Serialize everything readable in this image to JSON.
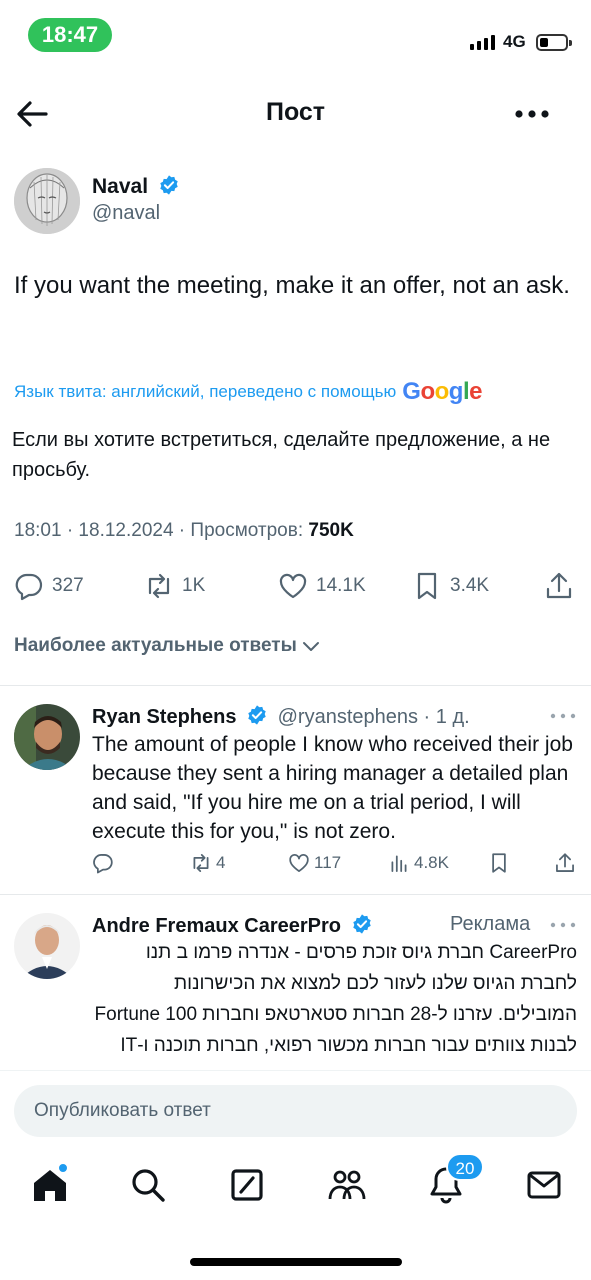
{
  "status_bar": {
    "time": "18:47",
    "network": "4G"
  },
  "header": {
    "title": "Пост",
    "back_icon": "arrow-left-icon",
    "more_icon": "more-horizontal-icon"
  },
  "post": {
    "author_name": "Naval",
    "author_handle": "@naval",
    "text": "If you want the meeting, make it an offer, not an ask.",
    "translation_note": "Язык твита: английский, переведено с помощью",
    "translation_provider": "Google",
    "translated_text": "Если вы хотите встретиться, сделайте предложение, а не просьбу.",
    "meta_prefix": "18:01 · 18.12.2024 · Просмотров:",
    "views": "750K",
    "stats": {
      "replies": "327",
      "reposts": "1K",
      "likes": "14.1K",
      "bookmarks": "3.4K"
    }
  },
  "sort": {
    "label": "Наиболее актуальные ответы"
  },
  "replies": [
    {
      "name": "Ryan Stephens",
      "handle": "@ryanstephens · 1 д.",
      "text": "The amount of people I know who received their job because they sent a hiring manager a detailed plan and said, \"If you hire me on a trial period, I will execute this for you,\" is not zero.",
      "stats": {
        "replies": "",
        "reposts": "4",
        "likes": "117",
        "views": "4.8K"
      }
    }
  ],
  "ad": {
    "name": "Andre Fremaux CareerPro",
    "label": "Реклама",
    "text": "CareerPro חברת גיוס זוכת פרסים - אנדרה פרמו ב תנו לחברת הגיוס שלנו לעזור לכם למצוא את הכישרונות המובילים. עזרנו ל-28 חברות סטארטאפ וחברות Fortune 100 לבנות צוותים עבור חברות מכשור רפואי, חברות תוכנה ו-IT וחברות בתחום הבריאות המובילות."
  },
  "composer": {
    "placeholder": "Опубликовать ответ"
  },
  "tabbar": {
    "items": [
      "home-icon",
      "search-icon",
      "compose-icon",
      "communities-icon",
      "notifications-icon",
      "messages-icon"
    ],
    "notifications_badge": "20"
  },
  "colors": {
    "accent": "#1d9bf0",
    "secondary_text": "#536471",
    "status_green": "#30c25b"
  }
}
